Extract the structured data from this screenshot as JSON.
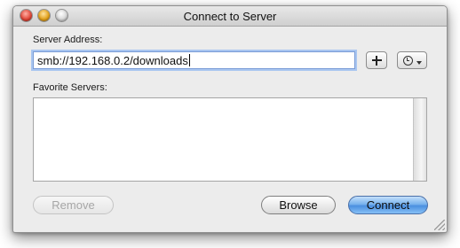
{
  "window": {
    "title": "Connect to Server"
  },
  "server_address": {
    "label": "Server Address:",
    "value": "smb://192.168.0.2/downloads"
  },
  "buttons": {
    "add_server_icon": "plus-icon",
    "recent_servers_icon": "clock-icon",
    "remove_label": "Remove",
    "browse_label": "Browse",
    "connect_label": "Connect"
  },
  "favorites": {
    "label": "Favorite Servers:",
    "items": []
  },
  "colors": {
    "default_button": "#6aa7ea",
    "focus_ring": "#a9c6f0"
  }
}
